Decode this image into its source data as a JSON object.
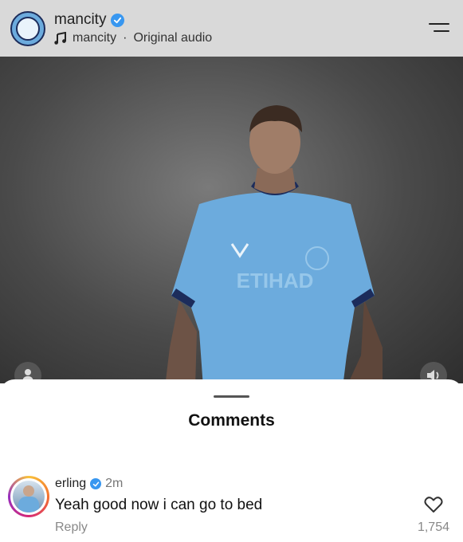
{
  "header": {
    "username": "mancity",
    "audio_artist": "mancity",
    "audio_separator": "·",
    "audio_title": "Original audio"
  },
  "comments_sheet": {
    "title": "Comments",
    "comments": [
      {
        "username": "erling",
        "time": "2m",
        "text": "Yeah good now i can go to bed",
        "reply_label": "Reply",
        "likes": "1,754"
      }
    ]
  },
  "colors": {
    "verified_badge": "#3897f0",
    "header_bg": "#d9d9d9",
    "jersey": "#6cabdd"
  },
  "icons": [
    "verified-icon",
    "music-note-icon",
    "menu-icon",
    "profile-icon",
    "speaker-icon",
    "heart-icon"
  ]
}
